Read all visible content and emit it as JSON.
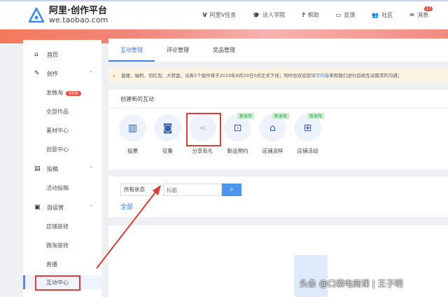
{
  "header": {
    "logo_title": "阿里·创作平台",
    "logo_domain": "we.taobao.com",
    "nav": [
      {
        "icon": "V",
        "label": "阿里V任务"
      },
      {
        "icon": "🎓",
        "label": "达人学院"
      },
      {
        "icon": "?",
        "label": "帮助"
      },
      {
        "icon": "▭",
        "label": "反馈"
      },
      {
        "icon": "👥",
        "label": "社区"
      },
      {
        "icon": "✉",
        "label": "消息",
        "badge": "17"
      }
    ]
  },
  "sidebar": {
    "items": [
      {
        "label": "首页",
        "icon": "⌂"
      },
      {
        "label": "创作",
        "icon": "✎"
      },
      {
        "label": "发微淘",
        "new": "NEW"
      },
      {
        "label": "全部作品"
      },
      {
        "label": "素材中心"
      },
      {
        "label": "创意中心"
      },
      {
        "label": "投稿",
        "icon": "▤"
      },
      {
        "label": "活动投稿"
      },
      {
        "label": "自运营",
        "icon": "▣"
      },
      {
        "label": "店铺装修"
      },
      {
        "label": "微淘装修"
      },
      {
        "label": "直播"
      },
      {
        "label": "互动中心"
      }
    ]
  },
  "tabs": [
    "互动管理",
    "评论管理",
    "奖品管理"
  ],
  "notice": {
    "text": "盖楼、福利、切红包、大转盘、派券5个组件将于2019年9月20日0点正式下线；同时也欢迎您",
    "link": "填写问卷",
    "text2": "来和我们进行后续互动需求的沟通；"
  },
  "create": {
    "title": "创建新的互动",
    "items": [
      {
        "label": "投票"
      },
      {
        "label": "征集"
      },
      {
        "label": "分享有礼"
      },
      {
        "label": "新品预约",
        "tag": "新发布"
      },
      {
        "label": "店铺派样",
        "tag": "新发布"
      },
      {
        "label": "店铺活动",
        "tag": "新发布"
      }
    ]
  },
  "filter": {
    "status": "所有状态",
    "placeholder": "标题",
    "all": "全部"
  },
  "watermark": "头条 @口袋电商课 | 王子明"
}
